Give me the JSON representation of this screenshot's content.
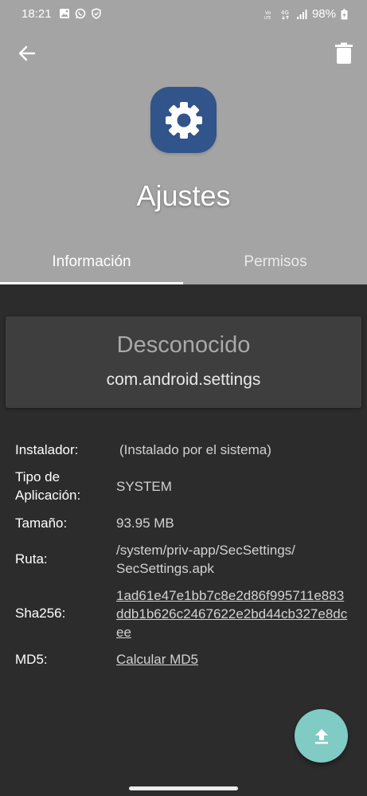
{
  "status_bar": {
    "time": "18:21",
    "network": "4G",
    "battery": "98%",
    "left_icons": [
      "gallery-icon",
      "whatsapp-icon",
      "shield-icon"
    ],
    "right_icons": [
      "volte-icon",
      "data-4g-icon",
      "signal-icon",
      "battery-charging-icon"
    ]
  },
  "toolbar": {
    "back_icon": "arrow-left-icon",
    "delete_icon": "trash-icon"
  },
  "app": {
    "name": "Ajustes",
    "icon": "gear-icon",
    "icon_color": "#31548a"
  },
  "tabs": [
    {
      "label": "Información",
      "active": true
    },
    {
      "label": "Permisos",
      "active": false
    }
  ],
  "card": {
    "title": "Desconocido",
    "package": "com.android.settings"
  },
  "info": {
    "installer_label": "Instalador:",
    "installer_value": "(Instalado por el sistema)",
    "type_label_1": "Tipo de",
    "type_label_2": "Aplicación:",
    "type_value": "SYSTEM",
    "size_label": "Tamaño:",
    "size_value": "93.95 MB",
    "path_label": "Ruta:",
    "path_value_1": "/system/priv-app/SecSettings/",
    "path_value_2": "SecSettings.apk",
    "sha_label": "Sha256:",
    "sha_value_1": "1ad61e47e1bb7c8e2d86f995711e883",
    "sha_value_2": "ddb1b626c2467622e2bd44cb327e8dc",
    "sha_value_3": "ee",
    "md5_label": "MD5:",
    "md5_value": "Calcular MD5"
  },
  "fab": {
    "icon": "upload-icon",
    "color": "#80cbc4"
  },
  "colors": {
    "header_bg": "#a4a4a4",
    "body_bg": "#2c2c2c",
    "card_bg": "#3e3e3e"
  }
}
